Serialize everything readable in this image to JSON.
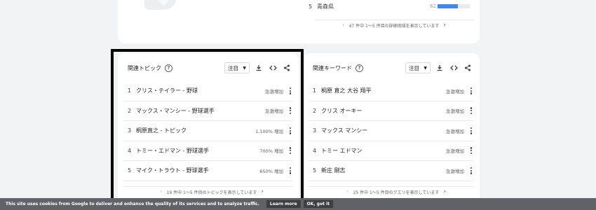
{
  "top_card": {
    "region_row": {
      "rank": "5",
      "name": "青森県",
      "value": "62",
      "fill_fraction": 0.62
    },
    "pager": {
      "text": "47 件中 1～5 件目の詳細地域を表示しています",
      "prev": "‹",
      "next": "›"
    }
  },
  "related_topics": {
    "title": "関連トピック",
    "select_value": "注目",
    "items": [
      {
        "rank": "1",
        "label": "クリス・テイラー - 野球",
        "metric": "急激増加"
      },
      {
        "rank": "2",
        "label": "マックス・マンシー - 野球選手",
        "metric": "急激増加"
      },
      {
        "rank": "3",
        "label": "桐原直之 - トピック",
        "metric": "1,100% 増加"
      },
      {
        "rank": "4",
        "label": "トミー・エドマン - 野球選手",
        "metric": "700% 増加"
      },
      {
        "rank": "5",
        "label": "マイク・トラウト - 野球選手",
        "metric": "650% 増加"
      }
    ],
    "pager": {
      "text": "19 件中 1～5 件目のトピックを表示しています",
      "prev": "‹",
      "next": "›"
    }
  },
  "related_keywords": {
    "title": "関連キーワード",
    "select_value": "注目",
    "items": [
      {
        "rank": "1",
        "label": "桐原 直之 大谷 翔平",
        "metric": "急激増加"
      },
      {
        "rank": "2",
        "label": "クリス オーキー",
        "metric": "急激増加"
      },
      {
        "rank": "3",
        "label": "マックス マンシー",
        "metric": "急激増加"
      },
      {
        "rank": "4",
        "label": "トミー エドマン",
        "metric": "急激増加"
      },
      {
        "rank": "5",
        "label": "新庄 剛志",
        "metric": "急激増加"
      }
    ],
    "pager": {
      "text": "25 件中 1～5 件目のクエリを表示しています",
      "prev": "‹",
      "next": "›"
    }
  },
  "cookie_bar": {
    "message": "This site uses cookies from Google to deliver and enhance the quality of its services and to analyze traffic.",
    "learn_more": "Learn more",
    "ok": "OK, got it"
  },
  "icons": [
    "help-icon",
    "download-icon",
    "embed-code-icon",
    "share-icon",
    "more-vert-icon",
    "chevron-left-icon",
    "chevron-right-icon",
    "caret-down-icon"
  ],
  "colors": {
    "bar": "#4285f4",
    "highlight": "#000000",
    "cookie_bar": "#5f6368"
  }
}
